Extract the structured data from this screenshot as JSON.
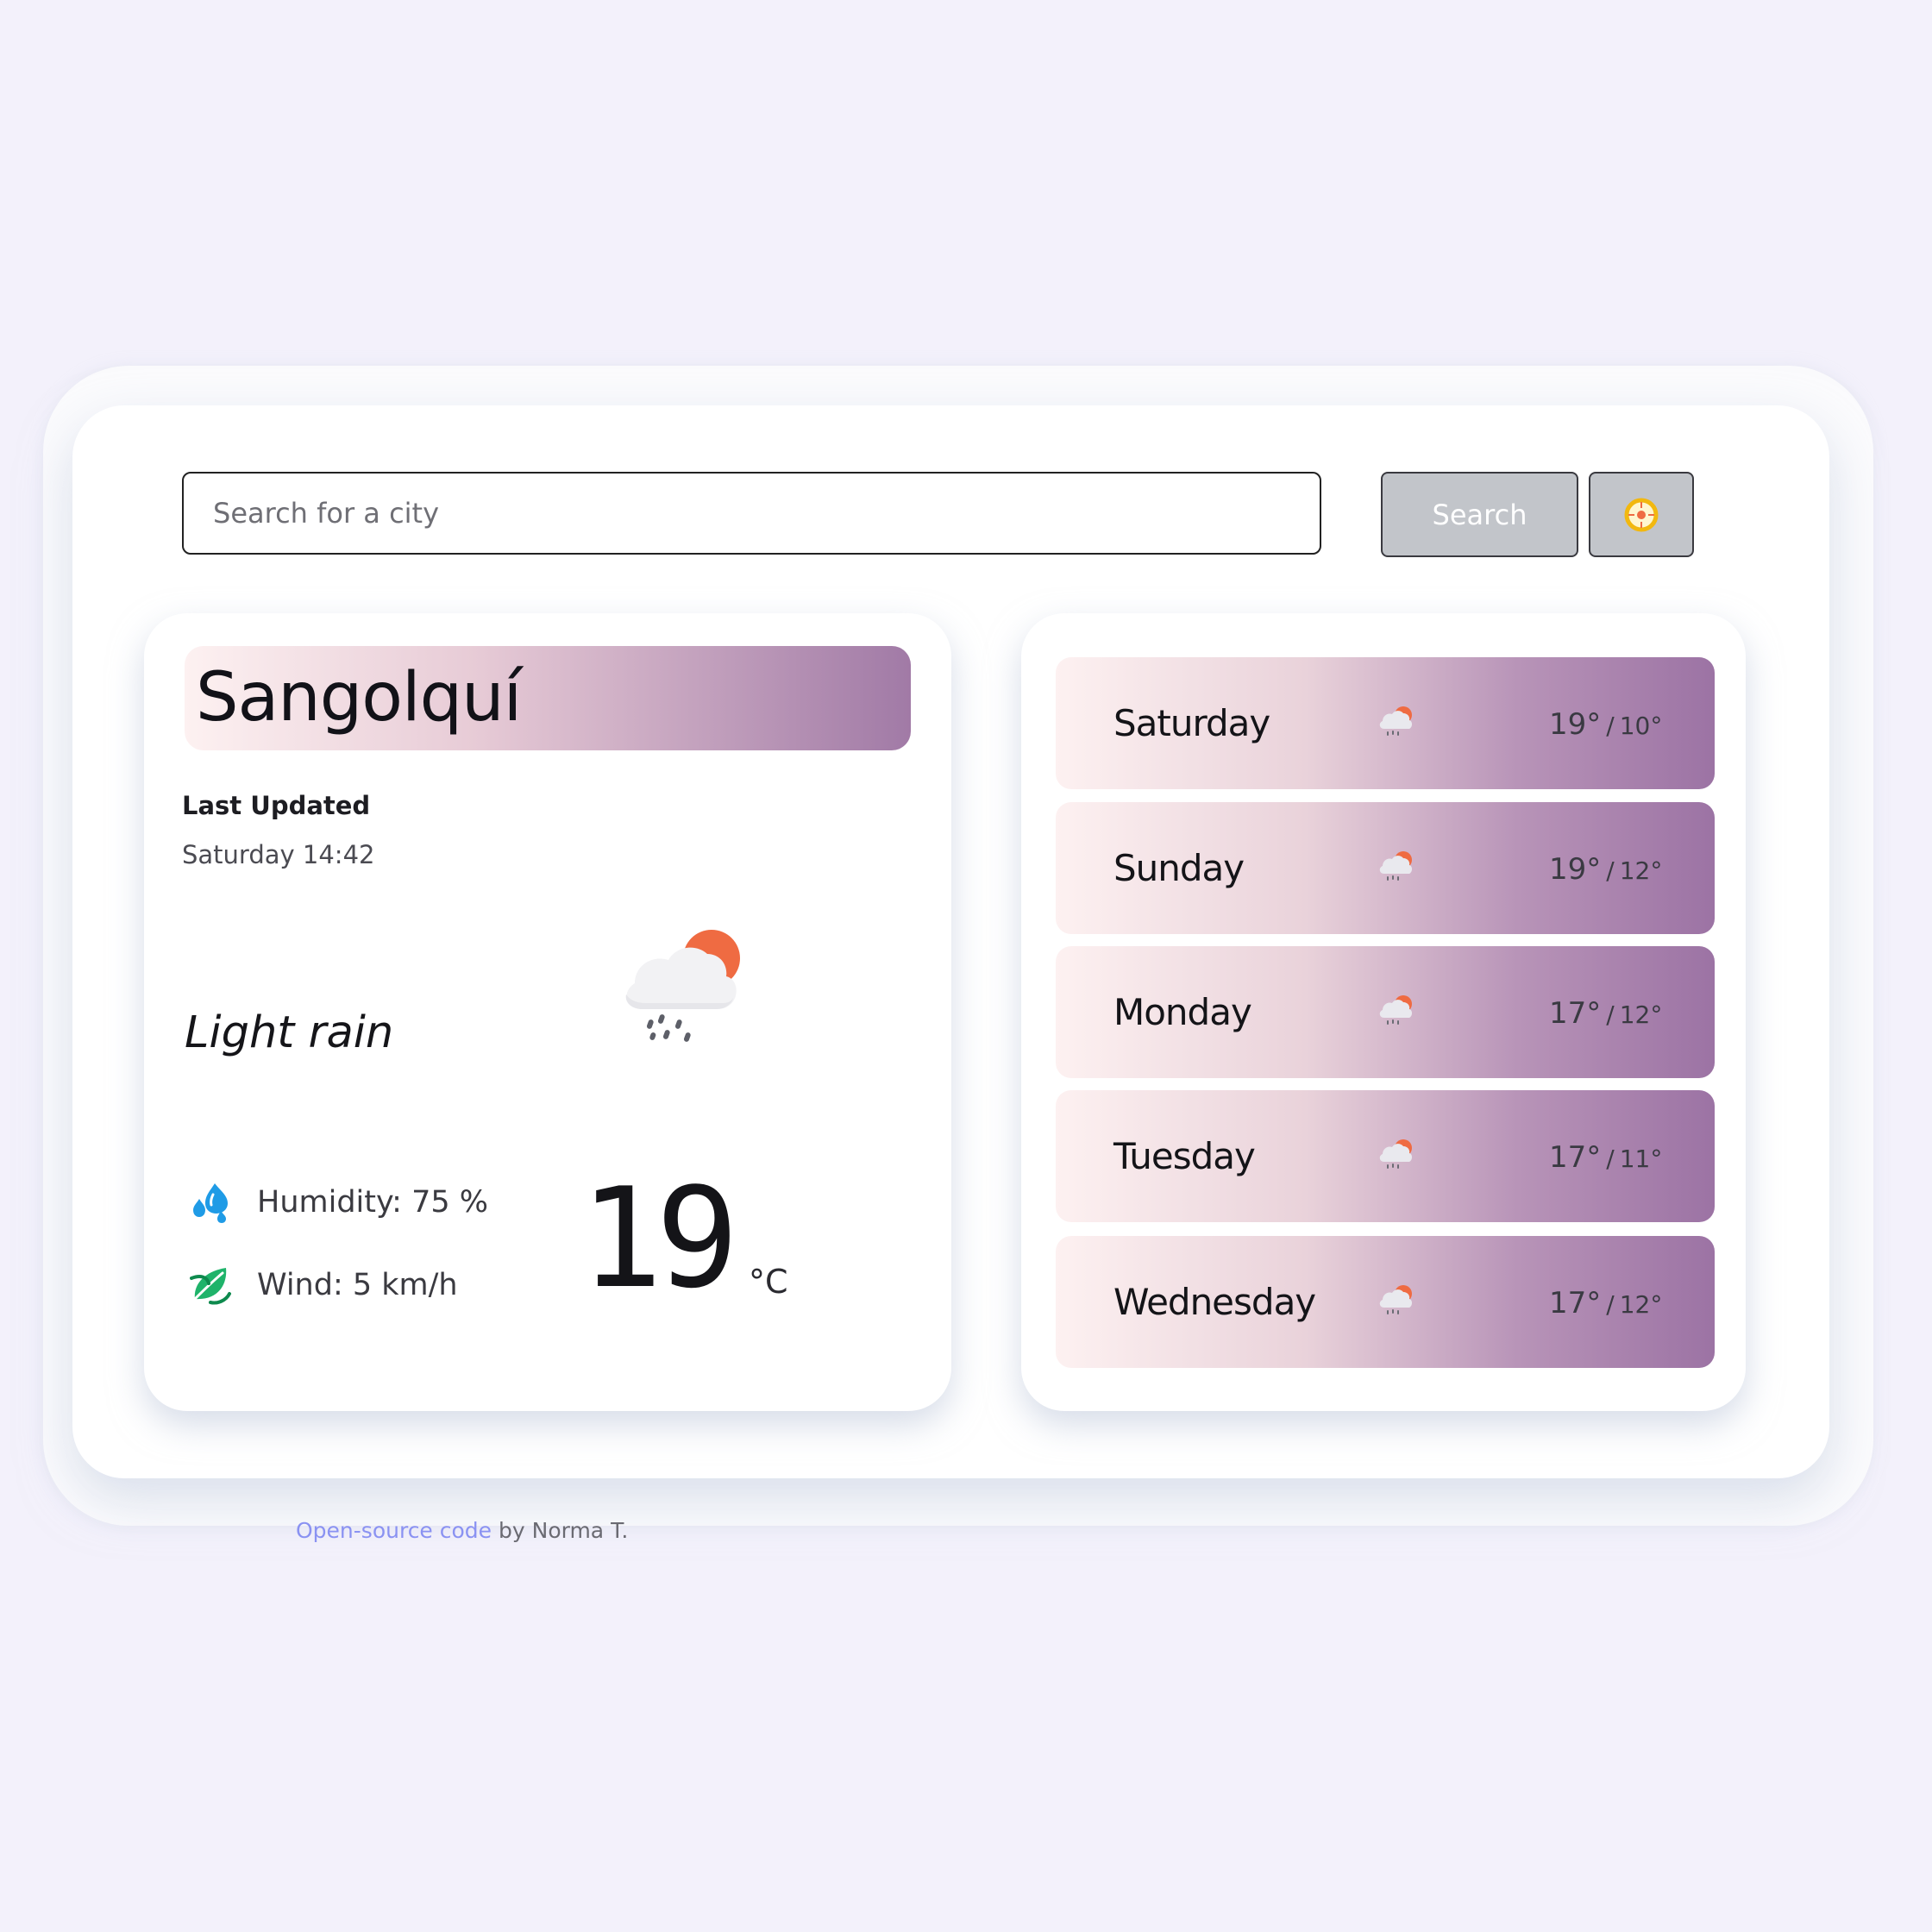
{
  "search": {
    "placeholder": "Search for a city",
    "button_label": "Search"
  },
  "location_button": {
    "icon": "location-icon"
  },
  "current": {
    "city": "Sangolquí",
    "last_updated_label": "Last Updated",
    "last_updated_value": "Saturday 14:42",
    "condition": "Light rain",
    "condition_icon": "light-rain-partly-sunny-icon",
    "humidity": "Humidity: 75 %",
    "humidity_icon": "water-drops-icon",
    "wind": "Wind: 5 km/h",
    "wind_icon": "wind-leaf-icon",
    "temperature": "19",
    "unit": "°C"
  },
  "forecast": [
    {
      "day": "Saturday",
      "max": "19",
      "min": "10",
      "icon": "light-rain-partly-sunny-icon"
    },
    {
      "day": "Sunday",
      "max": "19",
      "min": "12",
      "icon": "light-rain-partly-sunny-icon"
    },
    {
      "day": "Monday",
      "max": "17",
      "min": "12",
      "icon": "light-rain-partly-sunny-icon"
    },
    {
      "day": "Tuesday",
      "max": "17",
      "min": "11",
      "icon": "light-rain-partly-sunny-icon"
    },
    {
      "day": "Wednesday",
      "max": "17",
      "min": "12",
      "icon": "light-rain-partly-sunny-icon"
    }
  ],
  "footer": {
    "link_text": "Open-source code",
    "suffix": " by Norma T."
  },
  "colors": {
    "page_background": "#f3f1fb",
    "gradient_start": "#fdf1f1",
    "gradient_end": "#9c73a4",
    "button_gray": "#c2c5ca",
    "sun_orange": "#ef6b42",
    "humidity_blue": "#1f9be6",
    "wind_green": "#1fb36a",
    "link_blue": "#8a92f2"
  }
}
